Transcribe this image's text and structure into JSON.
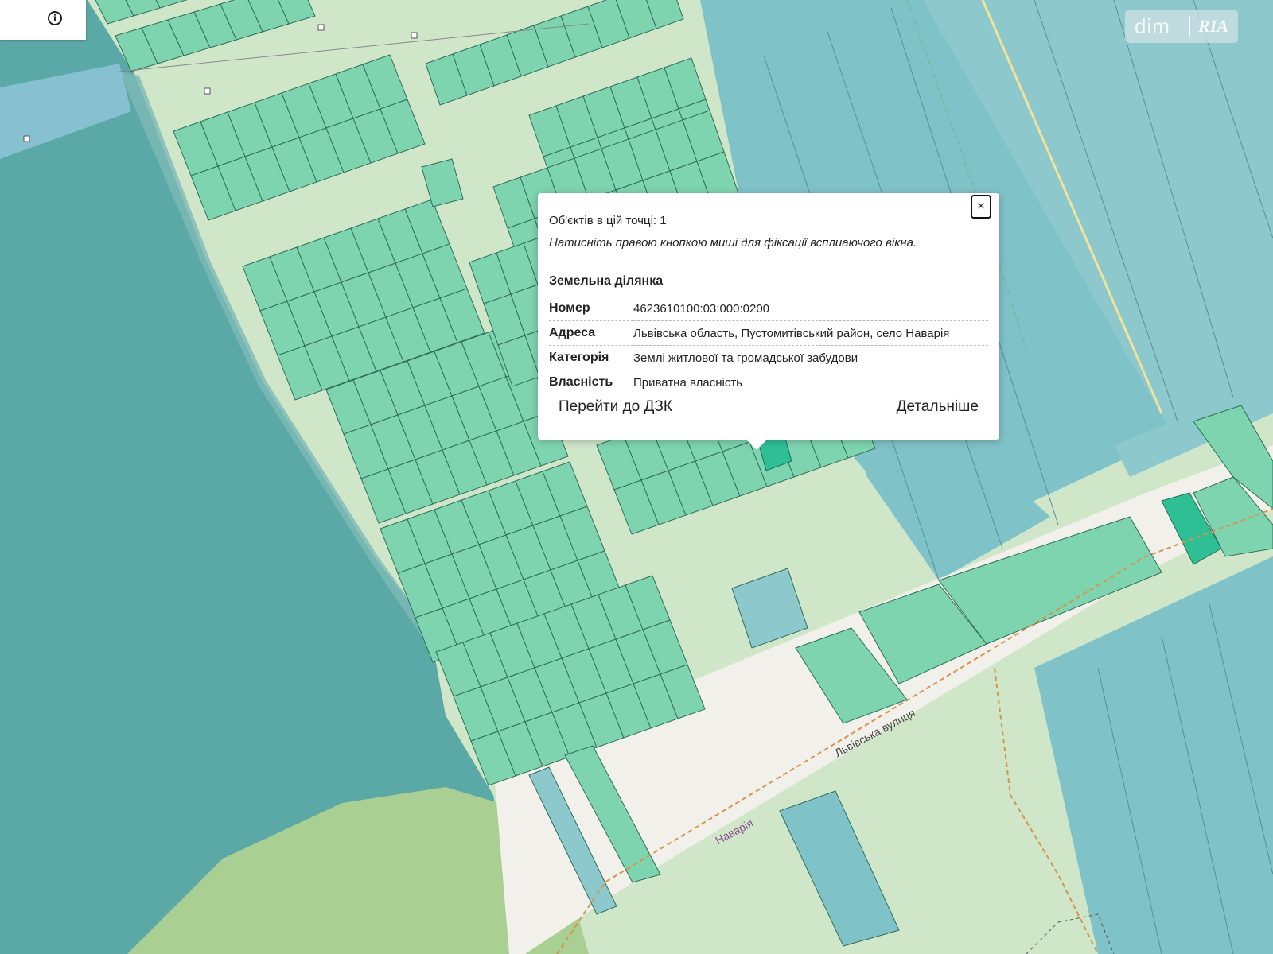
{
  "logo": {
    "brand": "dim",
    "partner": "RIA"
  },
  "street_labels": {
    "main": "Львівська вулиця",
    "secondary": "Наварія"
  },
  "popup": {
    "count_text": "Об'єктів в цій точці: 1",
    "hint_text": "Натисніть правою кнопкою миші для фіксації всплиаючого вікна.",
    "section_title": "Земельна ділянка",
    "close_label": "×",
    "rows": [
      {
        "key": "Номер",
        "value": "4623610100:03:000:0200"
      },
      {
        "key": "Адреса",
        "value": "Львівська область, Пустомитівський район, село Наварія"
      },
      {
        "key": "Категорія",
        "value": "Землі житлової та громадської забудови"
      },
      {
        "key": "Власність",
        "value": "Приватна власність"
      }
    ],
    "btn_dzk": "Перейти до ДЗК",
    "btn_details": "Детальніше"
  },
  "colors": {
    "water": "#5aa9a6",
    "meadow": "#cfe6c9",
    "parcel": "#7fd4b0",
    "parcel_selected": "#2fbf95",
    "field": "#7fc2c8",
    "field_light": "#8cc8cc",
    "forest": "#a9cf92",
    "road": "#f2f0eb",
    "canal": "#8ec4d8"
  }
}
